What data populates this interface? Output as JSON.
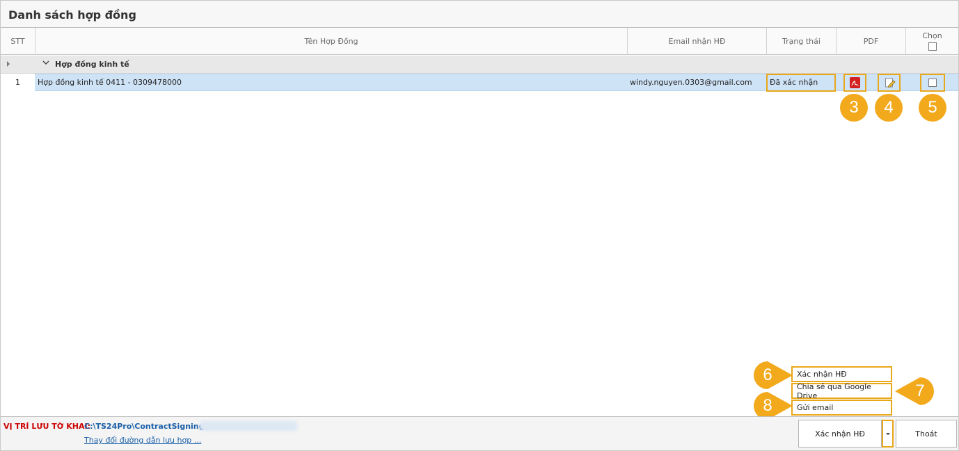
{
  "window": {
    "title": "Danh sách hợp đồng"
  },
  "columns": {
    "stt": "STT",
    "name": "Tên Hợp Đồng",
    "email": "Email nhận HĐ",
    "status": "Trạng thái",
    "pdf": "PDF",
    "select": "Chọn"
  },
  "group": {
    "label": "Hợp đồng kinh tế"
  },
  "rows": [
    {
      "stt": "1",
      "name": "Hợp đồng kinh tế 0411 - 0309478000",
      "email": "windy.nguyen.0303@gmail.com",
      "status": "Đã xác nhận"
    }
  ],
  "callouts": [
    "3",
    "4",
    "5",
    "6",
    "7",
    "8"
  ],
  "dropdown_menu": [
    "Xác nhận HĐ",
    "Chia sẻ qua Google Drive",
    "Gửi email"
  ],
  "footer": {
    "path_label": "VỊ TRÍ LƯU TỜ KHAI:",
    "path_value": "C:\\TS24Pro\\ContractSigning\\",
    "change_path_link": "Thay đổi đường dẫn lưu hợp ...",
    "confirm_button": "Xác nhận HĐ",
    "exit_button": "Thoát"
  },
  "colors": {
    "accent": "#f2a91c",
    "selection": "#cfe3f7",
    "path_label": "#cc0000",
    "path_value": "#1a5fa8",
    "pdf_icon": "#d32020"
  }
}
